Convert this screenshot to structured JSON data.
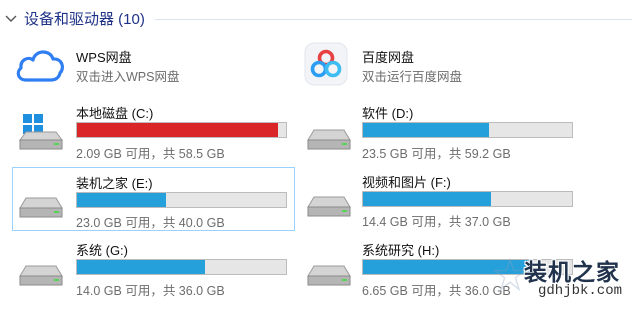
{
  "group": {
    "title": "设备和驱动器 (10)"
  },
  "apps": [
    {
      "name": "WPS网盘",
      "desc": "双击进入WPS网盘",
      "icon": "wps-cloud-icon"
    },
    {
      "name": "百度网盘",
      "desc": "双击运行百度网盘",
      "icon": "baidu-netdisk-icon"
    }
  ],
  "drives": [
    {
      "label": "本地磁盘 (C:)",
      "usage": "2.09 GB 可用，共 58.5 GB",
      "used_fraction": 0.964,
      "icon": "windows-drive-icon",
      "near_full": true
    },
    {
      "label": "软件 (D:)",
      "usage": "23.5 GB 可用，共 59.2 GB",
      "used_fraction": 0.603,
      "icon": "hard-drive-icon",
      "near_full": false
    },
    {
      "label": "装机之家 (E:)",
      "usage": "23.0 GB 可用，共 40.0 GB",
      "used_fraction": 0.425,
      "icon": "hard-drive-icon",
      "near_full": false
    },
    {
      "label": "视频和图片 (F:)",
      "usage": "14.4 GB 可用，共 37.0 GB",
      "used_fraction": 0.611,
      "icon": "hard-drive-icon",
      "near_full": false
    },
    {
      "label": "系统 (G:)",
      "usage": "14.0 GB 可用，共 36.0 GB",
      "used_fraction": 0.611,
      "icon": "hard-drive-icon",
      "near_full": false
    },
    {
      "label": "系统研究 (H:)",
      "usage": "6.65 GB 可用，共 36.0 GB",
      "used_fraction": 0.815,
      "icon": "hard-drive-icon",
      "near_full": false
    }
  ],
  "watermark": {
    "title": "装机之家",
    "url": "gdhjbk.com"
  },
  "colors": {
    "bar_fill": "#26a0da",
    "bar_full": "#da2626",
    "header_text": "#1e3287"
  }
}
